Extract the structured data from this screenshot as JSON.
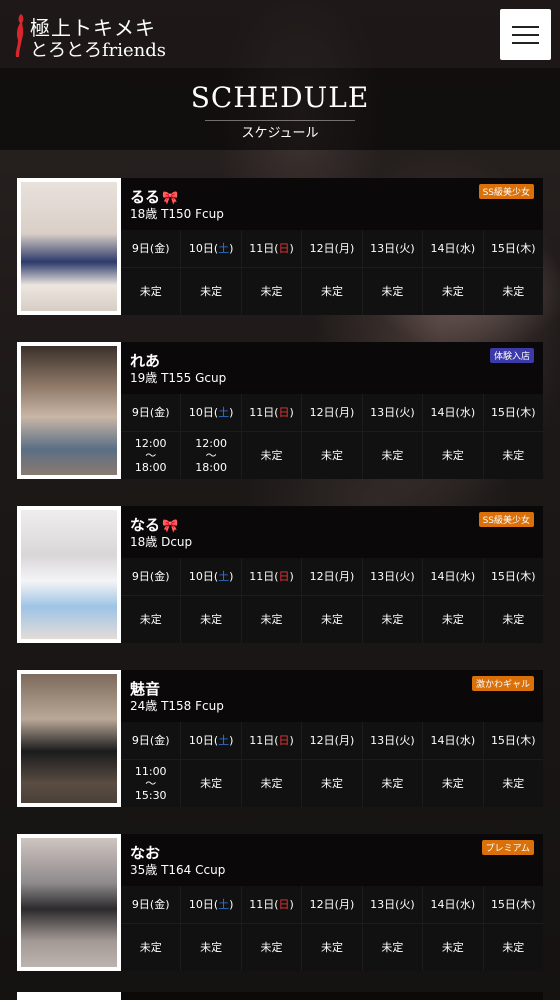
{
  "header": {
    "logo_line1": "極上トキメキ",
    "logo_line2": "とろとろfriends",
    "menu_icon": "hamburger-icon"
  },
  "page": {
    "title": "SCHEDULE",
    "subtitle": "スケジュール"
  },
  "colors": {
    "badge_orange": "#d9700a",
    "badge_purple": "#3b3aa8",
    "saturday": "#2f7ae5",
    "sunday": "#e33333",
    "ribbon": "#e8438c"
  },
  "cast": [
    {
      "name": "るる",
      "ribbon": "🎀",
      "stats": "18歳 T150 Fcup",
      "badge": "SS級美少女",
      "badge_color": "orange",
      "days": [
        {
          "d": "9日",
          "w": "金",
          "v": "未定"
        },
        {
          "d": "10日",
          "w": "土",
          "v": "未定"
        },
        {
          "d": "11日",
          "w": "日",
          "v": "未定"
        },
        {
          "d": "12日",
          "w": "月",
          "v": "未定"
        },
        {
          "d": "13日",
          "w": "火",
          "v": "未定"
        },
        {
          "d": "14日",
          "w": "水",
          "v": "未定"
        },
        {
          "d": "15日",
          "w": "木",
          "v": "未定"
        }
      ]
    },
    {
      "name": "れあ",
      "ribbon": "",
      "stats": "19歳 T155 Gcup",
      "badge": "体験入店",
      "badge_color": "purple",
      "days": [
        {
          "d": "9日",
          "w": "金",
          "v": "12:00\n～\n18:00"
        },
        {
          "d": "10日",
          "w": "土",
          "v": "12:00\n～\n18:00"
        },
        {
          "d": "11日",
          "w": "日",
          "v": "未定"
        },
        {
          "d": "12日",
          "w": "月",
          "v": "未定"
        },
        {
          "d": "13日",
          "w": "火",
          "v": "未定"
        },
        {
          "d": "14日",
          "w": "水",
          "v": "未定"
        },
        {
          "d": "15日",
          "w": "木",
          "v": "未定"
        }
      ]
    },
    {
      "name": "なる",
      "ribbon": "🎀",
      "stats": "18歳 Dcup",
      "badge": "SS級美少女",
      "badge_color": "orange",
      "days": [
        {
          "d": "9日",
          "w": "金",
          "v": "未定"
        },
        {
          "d": "10日",
          "w": "土",
          "v": "未定"
        },
        {
          "d": "11日",
          "w": "日",
          "v": "未定"
        },
        {
          "d": "12日",
          "w": "月",
          "v": "未定"
        },
        {
          "d": "13日",
          "w": "火",
          "v": "未定"
        },
        {
          "d": "14日",
          "w": "水",
          "v": "未定"
        },
        {
          "d": "15日",
          "w": "木",
          "v": "未定"
        }
      ]
    },
    {
      "name": "魅音",
      "ribbon": "",
      "stats": "24歳 T158 Fcup",
      "badge": "激かわギャル",
      "badge_color": "orange",
      "days": [
        {
          "d": "9日",
          "w": "金",
          "v": "11:00\n～\n15:30"
        },
        {
          "d": "10日",
          "w": "土",
          "v": "未定"
        },
        {
          "d": "11日",
          "w": "日",
          "v": "未定"
        },
        {
          "d": "12日",
          "w": "月",
          "v": "未定"
        },
        {
          "d": "13日",
          "w": "火",
          "v": "未定"
        },
        {
          "d": "14日",
          "w": "水",
          "v": "未定"
        },
        {
          "d": "15日",
          "w": "木",
          "v": "未定"
        }
      ]
    },
    {
      "name": "なお",
      "ribbon": "",
      "stats": "35歳 T164 Ccup",
      "badge": "プレミアム",
      "badge_color": "orange",
      "days": [
        {
          "d": "9日",
          "w": "金",
          "v": "未定"
        },
        {
          "d": "10日",
          "w": "土",
          "v": "未定"
        },
        {
          "d": "11日",
          "w": "日",
          "v": "未定"
        },
        {
          "d": "12日",
          "w": "月",
          "v": "未定"
        },
        {
          "d": "13日",
          "w": "火",
          "v": "未定"
        },
        {
          "d": "14日",
          "w": "水",
          "v": "未定"
        },
        {
          "d": "15日",
          "w": "木",
          "v": "未定"
        }
      ]
    }
  ]
}
